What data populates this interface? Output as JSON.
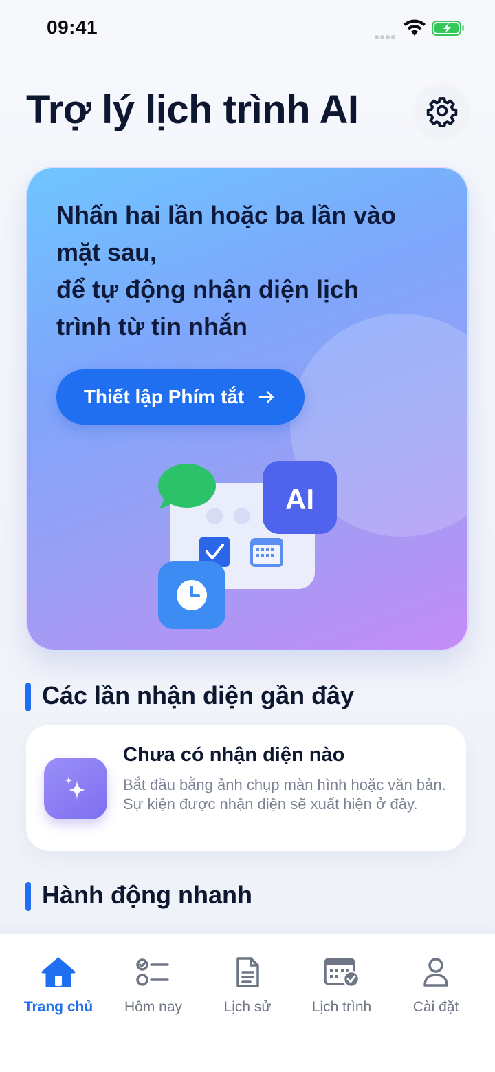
{
  "status": {
    "time": "09:41"
  },
  "header": {
    "title": "Trợ lý lịch trình AI"
  },
  "hero": {
    "lines": [
      "Nhấn hai lần hoặc ba lần vào",
      "mặt sau,",
      "để tự động nhận diện lịch",
      "trình từ tin nhắn"
    ],
    "button_label": "Thiết lập Phím tắt",
    "ai_badge": "AI"
  },
  "recent": {
    "title": "Các lần nhận diện gần đây",
    "empty_title": "Chưa có nhận diện nào",
    "empty_desc": "Bắt đầu bằng ảnh chụp màn hình hoặc văn bản. Sự kiện được nhận diện sẽ xuất hiện ở đây."
  },
  "quick": {
    "title": "Hành động nhanh"
  },
  "tabs": [
    {
      "label": "Trang chủ",
      "icon": "home-icon",
      "active": true
    },
    {
      "label": "Hôm nay",
      "icon": "checklist-icon",
      "active": false
    },
    {
      "label": "Lịch sử",
      "icon": "document-icon",
      "active": false
    },
    {
      "label": "Lịch trình",
      "icon": "calendar-check-icon",
      "active": false
    },
    {
      "label": "Cài đặt",
      "icon": "person-icon",
      "active": false
    }
  ],
  "colors": {
    "accent": "#1f6ff0",
    "inactive": "#6e7686",
    "title": "#0d1730"
  }
}
